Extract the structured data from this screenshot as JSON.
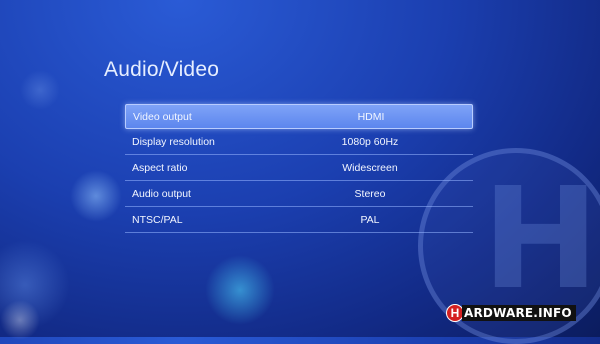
{
  "page_title": "Audio/Video",
  "settings": [
    {
      "label": "Video output",
      "value": "HDMI"
    },
    {
      "label": "Display resolution",
      "value": "1080p 60Hz"
    },
    {
      "label": "Aspect ratio",
      "value": "Widescreen"
    },
    {
      "label": "Audio output",
      "value": "Stereo"
    },
    {
      "label": "NTSC/PAL",
      "value": "PAL"
    }
  ],
  "selected_index": 0,
  "watermark": {
    "letter": "H",
    "brand_text": "ARDWARE.INFO",
    "brand_color": "#d42020"
  },
  "colors": {
    "background": "#1b3fb0",
    "highlight": "#6f96f3"
  }
}
